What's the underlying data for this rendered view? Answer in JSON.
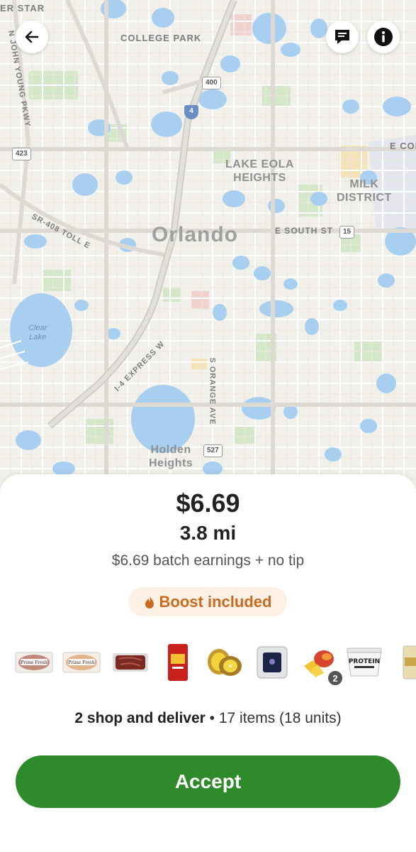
{
  "map": {
    "labels": {
      "top_left": "ER STAR",
      "college_park": "COLLEGE PARK",
      "john_young": "N JOHN YOUNG PKWY",
      "lake_eola_1": "LAKE EOLA",
      "lake_eola_2": "HEIGHTS",
      "milk_1": "MILK",
      "milk_2": "DISTRICT",
      "orlando": "Orlando",
      "south_st": "E SOUTH ST",
      "e_col": "E COL",
      "toll": "SR-408 TOLL E",
      "express": "I-4 EXPRESS W",
      "orange_ave": "S ORANGE AVE",
      "clear_lake_1": "Clear",
      "clear_lake_2": "Lake",
      "holden_1": "Holden",
      "holden_2": "Heights"
    },
    "shields": {
      "s400": "400",
      "s423": "423",
      "s527": "527",
      "s15": "15",
      "i4": "4"
    }
  },
  "offer": {
    "earnings": "$6.69",
    "distance": "3.8 mi",
    "breakdown": "$6.69 batch earnings + no tip",
    "boost_label": "Boost included",
    "summary_bold": "2 shop and deliver",
    "summary_rest": " • 17 items (18 units)",
    "accept_label": "Accept"
  },
  "items": [
    {
      "name": "prime-fresh-ham",
      "label": "Prime Fresh"
    },
    {
      "name": "prime-fresh-turkey",
      "label": "Prime Fresh"
    },
    {
      "name": "steak",
      "label": ""
    },
    {
      "name": "pasta-bag",
      "label": ""
    },
    {
      "name": "kiwi",
      "label": ""
    },
    {
      "name": "packaged-item",
      "label": ""
    },
    {
      "name": "mango",
      "label": "",
      "quantity": "2"
    },
    {
      "name": "protein-yogurt",
      "label": "PROTEIN"
    },
    {
      "name": "partial-item",
      "label": ""
    }
  ],
  "colors": {
    "accept": "#2f8a2b",
    "boost_text": "#c96a1e",
    "boost_bg": "#fdf0e4",
    "water": "#a9cff0",
    "park": "#d3e8c8"
  }
}
